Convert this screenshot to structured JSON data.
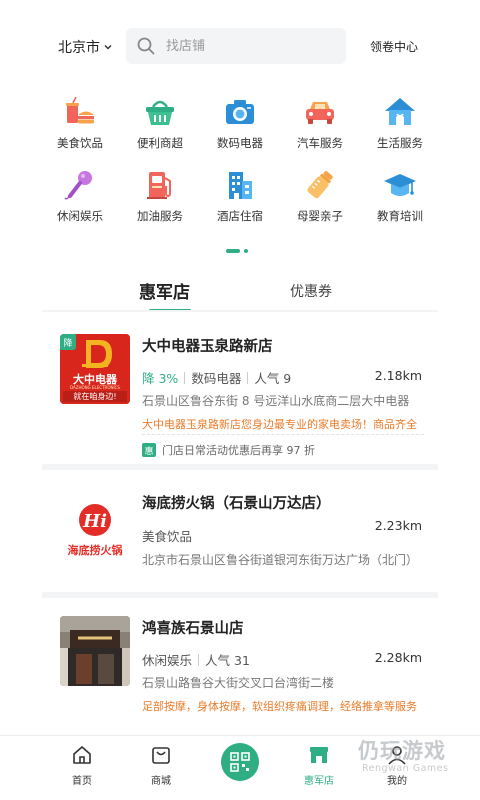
{
  "header": {
    "city": "北京市",
    "search_placeholder": "找店铺",
    "coupon_center": "领卷中心"
  },
  "categories": [
    {
      "label": "美食饮品",
      "icon": "food-drink-icon"
    },
    {
      "label": "便利商超",
      "icon": "basket-icon"
    },
    {
      "label": "数码电器",
      "icon": "camera-icon"
    },
    {
      "label": "汽车服务",
      "icon": "car-icon"
    },
    {
      "label": "生活服务",
      "icon": "house-icon"
    },
    {
      "label": "休闲娱乐",
      "icon": "microphone-icon"
    },
    {
      "label": "加油服务",
      "icon": "fuel-pump-icon"
    },
    {
      "label": "酒店住宿",
      "icon": "hotel-icon"
    },
    {
      "label": "母婴亲子",
      "icon": "baby-bottle-icon"
    },
    {
      "label": "教育培训",
      "icon": "graduation-cap-icon"
    }
  ],
  "tabs": {
    "active": "惠军店",
    "other": "优惠券"
  },
  "stores": [
    {
      "badge": "降",
      "logo_text": "大中电器",
      "logo_sub": "DAZHONG ELECTRONICS",
      "logo_slogan": "就在咱身边!",
      "name": "大中电器玉泉路新店",
      "discount": "降 3%",
      "category": "数码电器",
      "popularity": "人气 9",
      "distance": "2.18km",
      "address": "石景山区鲁谷东街 8 号远洋山水底商二层大中电器",
      "promo": "大中电器玉泉路新店您身边最专业的家电卖场！商品齐全",
      "activity_tag": "惠",
      "activity": "门店日常活动优惠后再享 97 折"
    },
    {
      "logo_text": "海底捞火锅",
      "name": "海底捞火锅（石景山万达店）",
      "category": "美食饮品",
      "distance": "2.23km",
      "address": "北京市石景山区鲁谷街道银河东街万达广场（北门）"
    },
    {
      "name": "鸿喜族石景山店",
      "category": "休闲娱乐",
      "popularity": "人气 31",
      "distance": "2.28km",
      "address": "石景山路鲁谷大街交叉口台湾街二楼",
      "promo": "足部按摩，身体按摩，软组织疼痛调理，经络推拿等服务"
    }
  ],
  "bottom_nav": {
    "home": "首页",
    "mall": "商城",
    "qr": "扫码",
    "hui": "惠军店",
    "mine": "我的"
  },
  "watermark": {
    "text": "仍玩游戏",
    "sub": "Rengwan Games"
  },
  "colors": {
    "accent": "#2fae84",
    "promo": "#e97b2a"
  }
}
